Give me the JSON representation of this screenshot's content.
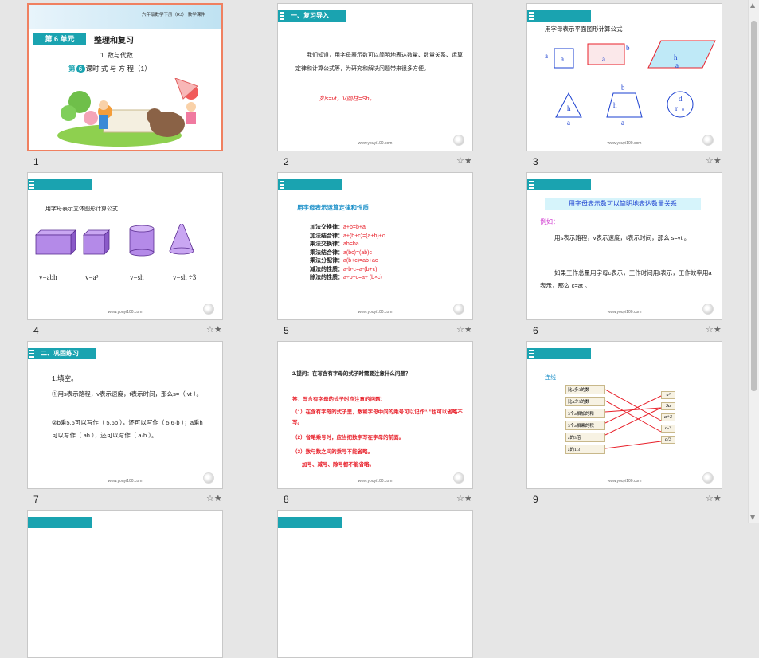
{
  "slides": [
    {
      "num": "1",
      "header_text": "六年级数学下册（RJ）   教学课件",
      "unit_label": "第 6 单元",
      "unit_title": "整理和复习",
      "section": "1. 数与代数",
      "lesson_prefix": "第",
      "lesson_no": "6",
      "lesson_title": "课时  式 与 方 程（1）"
    },
    {
      "num": "2",
      "tag": "一、复习导入",
      "paragraph": "我们知道，用字母表示数可以简明地表达数量、数量关系、运算定律和计算公式等，为研究和解决问题带来很多方便。",
      "formula": "如s=vt，V圆柱=Sh。",
      "footer": "www.youyi100.com"
    },
    {
      "num": "3",
      "title": "用字母表示平面图形计算公式",
      "formulas": [
        "a",
        "a",
        "b",
        "a",
        "h",
        "a",
        "h",
        "a",
        "h",
        "b",
        "a",
        "d",
        "r",
        "o"
      ],
      "footer": "www.youyi100.com"
    },
    {
      "num": "4",
      "title": "用字母表示立体图形计算公式",
      "formulas": [
        "v=abh",
        "v=a³",
        "v=sh",
        "v=sh ÷3"
      ],
      "footer": "www.youyi100.com"
    },
    {
      "num": "5",
      "title": "用字母表示运算定律和性质",
      "rows": [
        {
          "k": "加法交换律：",
          "v": "a+b=b+a"
        },
        {
          "k": "加法结合律：",
          "v": "a+(b+c)=(a+b)+c"
        },
        {
          "k": "乘法交换律：",
          "v": "ab=ba"
        },
        {
          "k": "乘法结合律：",
          "v": "a(bc)=(ab)c"
        },
        {
          "k": "乘法分配律：",
          "v": "a(b+c)=ab+ac"
        },
        {
          "k": "减法的性质：",
          "v": "a-b-c=a-(b+c)"
        },
        {
          "k": "除法的性质：",
          "v": "a÷b÷c=a÷ (b×c)"
        }
      ],
      "footer": "www.youyi100.com"
    },
    {
      "num": "6",
      "banner": "用字母表示数可以简明地表达数量关系",
      "example": "例如：",
      "line1": "用s表示路程，v表示速度，t表示时间，那么 s=vt 。",
      "line2": "如果工作总量用字母c表示，工作时间用t表示，工作效率用a表示，那么 c=at 。",
      "footer": "www.youyi100.com"
    },
    {
      "num": "7",
      "tag": "二、巩固练习",
      "q": "1.填空。",
      "l1": "①用s表示路程，v表示速度，t表示时间，那么s=（  vt  ）。",
      "l2": "②b乘5.6可以写作（ 5.6b ），还可以写作（ 5.6·b ）；a乘h可以写作（  ah  ），还可以写作（ a·h ）。",
      "footer": "www.youyi100.com"
    },
    {
      "num": "8",
      "question": "2.提问：在写含有字母的式子时需要注意什么问题？",
      "answer_title": "答：写含有字母的式子时应注意的问题：",
      "a1": "（1）在含有字母的式子里，数和字母中间的乘号可以记作“·”也可以省略不写。",
      "a2": "（2）省略乘号时，应当把数字写在字母的前面。",
      "a3": "（3）数与数之间的乘号不能省略。",
      "a4": "加号、减号、除号都不能省略。",
      "footer": "www.youyi100.com"
    },
    {
      "num": "9",
      "title": "连线",
      "left": [
        "比a多3的数",
        "比a少3的数",
        "3个a相加的和",
        "3个a相乘的积",
        "a的3倍",
        "a的1/3"
      ],
      "right": [
        "a³",
        "3a",
        "a+3",
        "a-3",
        "a/3"
      ],
      "footer": "www.youyi100.com"
    }
  ],
  "star_glyph": "☆★",
  "colors": {
    "teal": "#1aa3b0",
    "red": "#e8202a",
    "blue": "#1a3fd0",
    "selected_border": "#f08060"
  }
}
